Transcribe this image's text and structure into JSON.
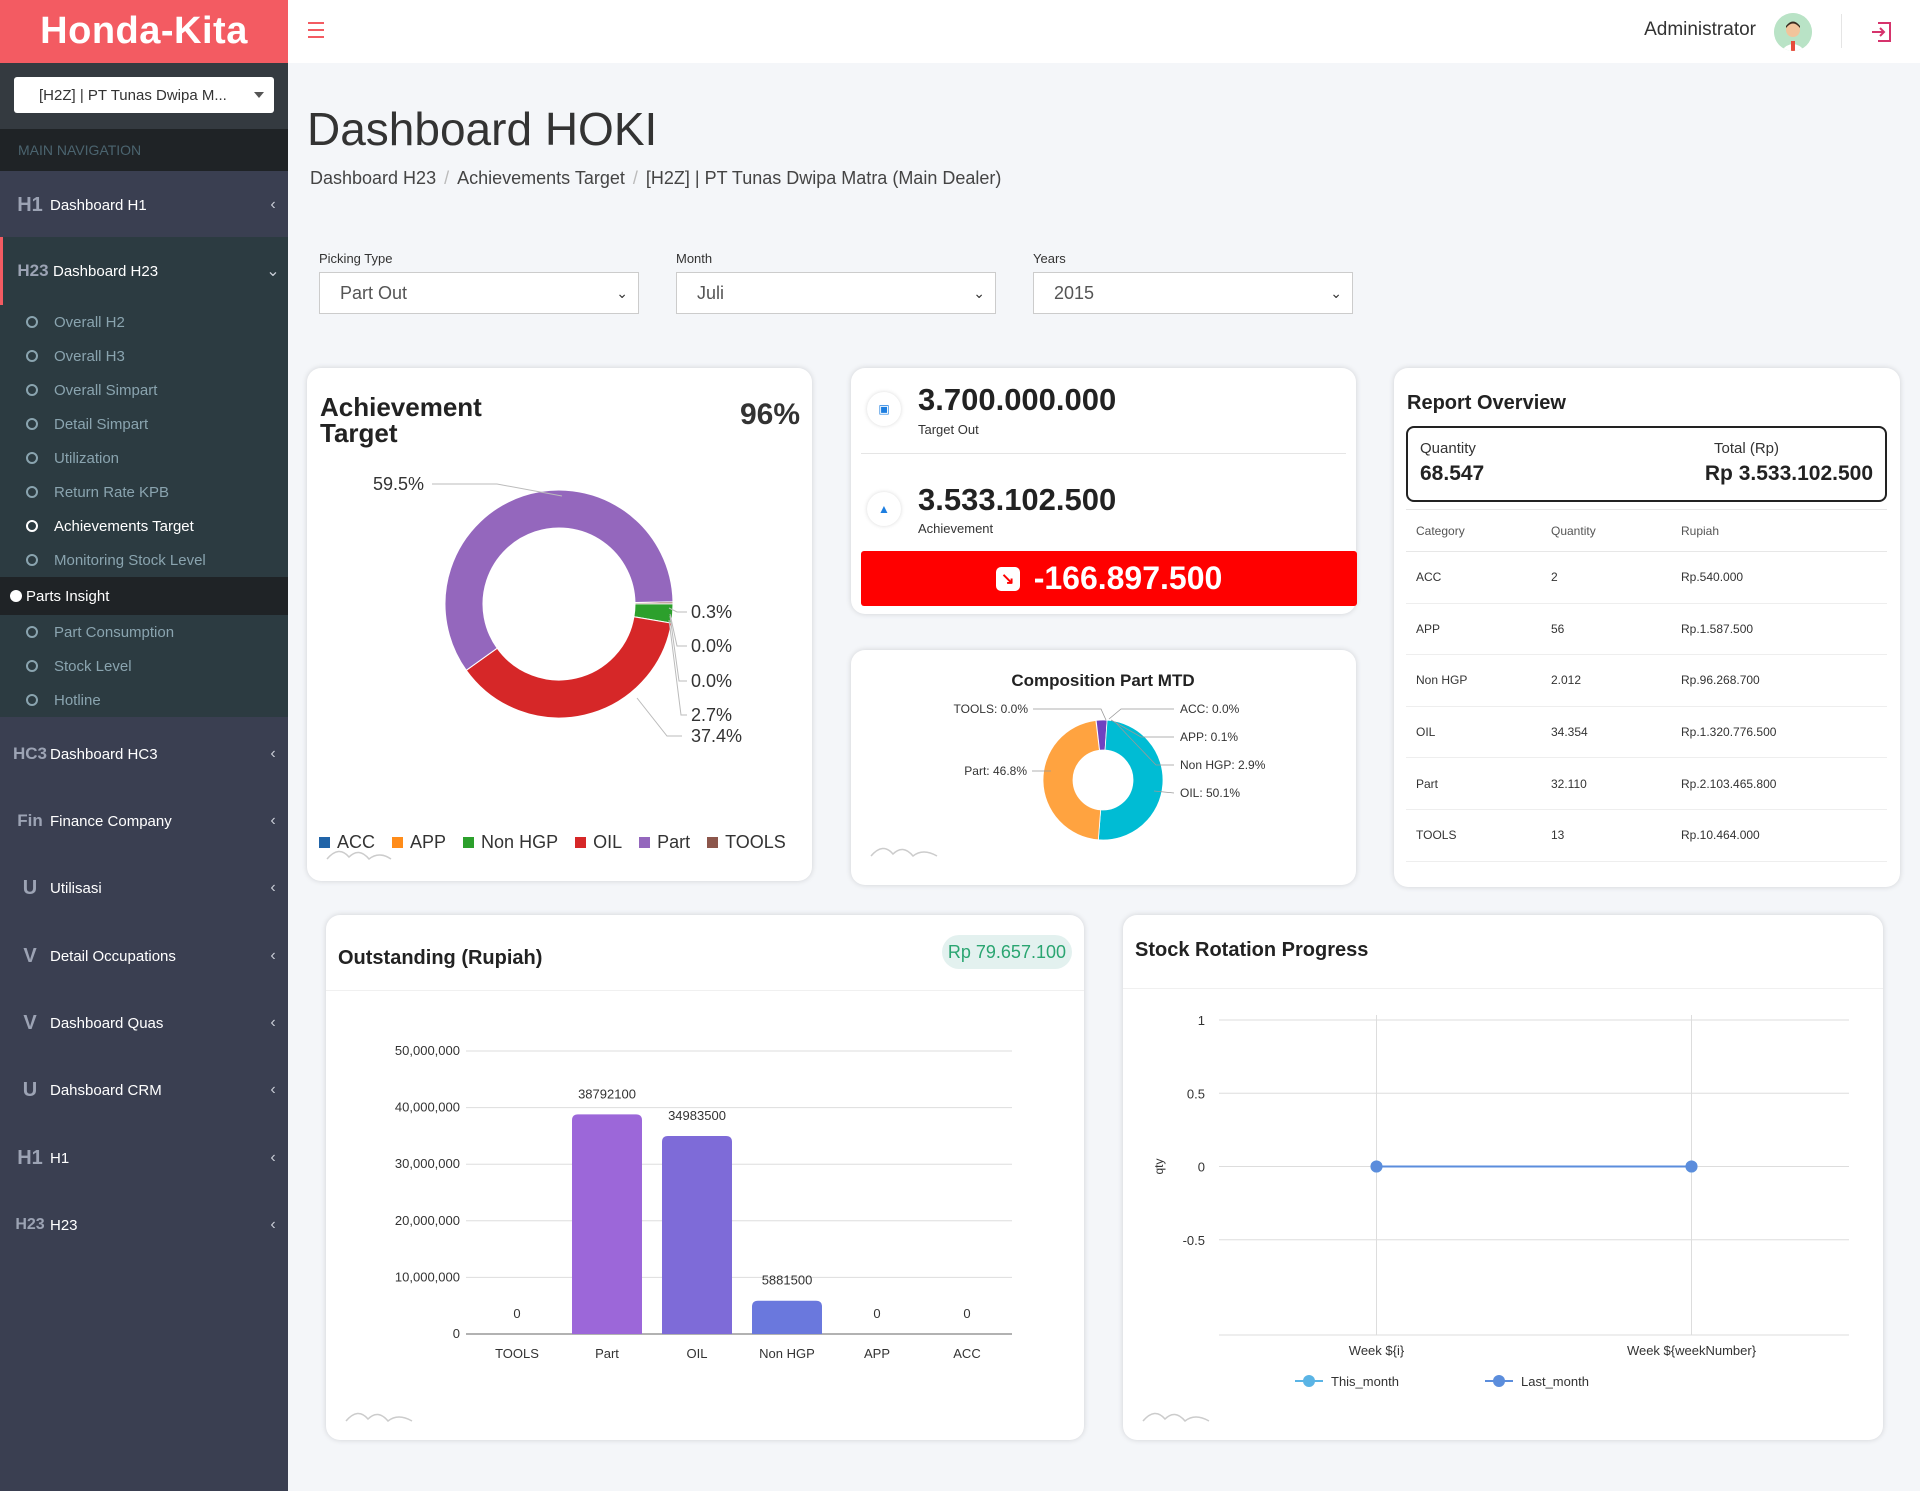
{
  "brand": "Honda-Kita",
  "dealer_select": "[H2Z] | PT Tunas Dwipa M...",
  "nav_header": "MAIN NAVIGATION",
  "nav": {
    "dashboard_h1": {
      "icon": "H1",
      "label": "Dashboard H1"
    },
    "dashboard_h23": {
      "icon": "H23",
      "label": "Dashboard H23"
    },
    "dashboard_h23_sub": [
      "Overall H2",
      "Overall H3",
      "Overall Simpart",
      "Detail Simpart",
      "Utilization",
      "Return Rate KPB",
      "Achievements Target",
      "Monitoring Stock Level"
    ],
    "parts_insight": "Parts Insight",
    "parts_insight_sub": [
      "Part Consumption",
      "Stock Level",
      "Hotline"
    ],
    "dashboard_hc3": {
      "icon": "HC3",
      "label": "Dashboard HC3"
    },
    "finance_company": {
      "icon": "Fin",
      "label": "Finance Company"
    },
    "utilisasi": {
      "icon": "U",
      "label": "Utilisasi"
    },
    "detail_occupations": {
      "icon": "V",
      "label": "Detail Occupations"
    },
    "dashboard_quas": {
      "icon": "V",
      "label": "Dashboard Quas"
    },
    "dashboard_crm": {
      "icon": "U",
      "label": "Dahsboard CRM"
    },
    "h1": {
      "icon": "H1",
      "label": "H1"
    },
    "h23": {
      "icon": "H23",
      "label": "H23"
    }
  },
  "topbar": {
    "admin": "Administrator"
  },
  "page_title": "Dashboard HOKI",
  "breadcrumb": [
    "Dashboard H23",
    "Achievements Target",
    "[H2Z] | PT Tunas Dwipa Matra (Main Dealer)"
  ],
  "filters": {
    "picking_type": {
      "label": "Picking Type",
      "value": "Part Out"
    },
    "month": {
      "label": "Month",
      "value": "Juli"
    },
    "years": {
      "label": "Years",
      "value": "2015"
    }
  },
  "achievement": {
    "title": "Achievement Target",
    "percent": "96%",
    "donut_labels": [
      "59.5%",
      "0.3%",
      "0.0%",
      "0.0%",
      "2.7%",
      "37.4%"
    ],
    "legend": [
      {
        "name": "ACC",
        "color": "#2164a8"
      },
      {
        "name": "APP",
        "color": "#ff8c1a"
      },
      {
        "name": "Non HGP",
        "color": "#2ca02c"
      },
      {
        "name": "OIL",
        "color": "#d62728"
      },
      {
        "name": "Part",
        "color": "#9467bd"
      },
      {
        "name": "TOOLS",
        "color": "#8c564b"
      }
    ]
  },
  "target": {
    "target_value": "3.700.000.000",
    "target_label": "Target Out",
    "achievement_value": "3.533.102.500",
    "achievement_label": "Achievement",
    "difference": "-166.897.500"
  },
  "composition": {
    "title": "Composition Part MTD",
    "labels": [
      "TOOLS: 0.0%",
      "ACC: 0.0%",
      "APP: 0.1%",
      "Non HGP: 2.9%",
      "Part: 46.8%",
      "OIL: 50.1%"
    ]
  },
  "report_overview": {
    "title": "Report Overview",
    "quantity_label": "Quantity",
    "quantity_value": "68.547",
    "total_label": "Total (Rp)",
    "total_value": "Rp 3.533.102.500",
    "columns": [
      "Category",
      "Quantity",
      "Rupiah"
    ],
    "rows": [
      [
        "ACC",
        "2",
        "Rp.540.000"
      ],
      [
        "APP",
        "56",
        "Rp.1.587.500"
      ],
      [
        "Non HGP",
        "2.012",
        "Rp.96.268.700"
      ],
      [
        "OIL",
        "34.354",
        "Rp.1.320.776.500"
      ],
      [
        "Part",
        "32.110",
        "Rp.2.103.465.800"
      ],
      [
        "TOOLS",
        "13",
        "Rp.10.464.000"
      ]
    ]
  },
  "outstanding": {
    "title": "Outstanding (Rupiah)",
    "badge": "Rp 79.657.100"
  },
  "stock_rotation": {
    "title": "Stock Rotation Progress"
  },
  "chart_data": [
    {
      "type": "pie",
      "title": "Achievement Target",
      "categories": [
        "ACC",
        "APP",
        "Non HGP",
        "OIL",
        "Part",
        "TOOLS"
      ],
      "values": [
        0.0,
        0.0,
        2.7,
        37.4,
        59.5,
        0.3
      ],
      "colors": [
        "#2164a8",
        "#ff8c1a",
        "#2ca02c",
        "#d62728",
        "#9467bd",
        "#8c564b"
      ],
      "legend": "bottom"
    },
    {
      "type": "pie",
      "title": "Composition Part MTD",
      "categories": [
        "TOOLS",
        "ACC",
        "APP",
        "Non HGP",
        "Part",
        "OIL"
      ],
      "values": [
        0.0,
        0.0,
        0.1,
        2.9,
        46.8,
        50.1
      ],
      "colors": [
        "#8c564b",
        "#2164a8",
        "#ff8c1a",
        "#6f42c1",
        "#ffa340",
        "#00bcd4"
      ]
    },
    {
      "type": "bar",
      "title": "Outstanding (Rupiah)",
      "categories": [
        "TOOLS",
        "Part",
        "OIL",
        "Non HGP",
        "APP",
        "ACC"
      ],
      "values": [
        0,
        38792100,
        34983500,
        5881500,
        0,
        0
      ],
      "ylim": [
        0,
        50000000
      ],
      "yticks": [
        "0",
        "10,000,000",
        "20,000,000",
        "30,000,000",
        "40,000,000",
        "50,000,000"
      ],
      "colors": [
        "#9c67d9",
        "#9c67d9",
        "#7e6bd8",
        "#6a78dd",
        "#6a78dd",
        "#6a78dd"
      ],
      "grid": true
    },
    {
      "type": "line",
      "title": "Stock Rotation Progress",
      "x": [
        "Week ${i}",
        "Week ${weekNumber}"
      ],
      "ylabel": "qty",
      "ylim": [
        -1,
        1
      ],
      "yticks": [
        "1",
        "0.5",
        "0",
        "-0.5"
      ],
      "series": [
        {
          "name": "This_month",
          "values": [
            0,
            0
          ],
          "color": "#5ab4e5"
        },
        {
          "name": "Last_month",
          "values": [
            0,
            0
          ],
          "color": "#5b8ddc"
        }
      ],
      "legend": "bottom"
    }
  ]
}
